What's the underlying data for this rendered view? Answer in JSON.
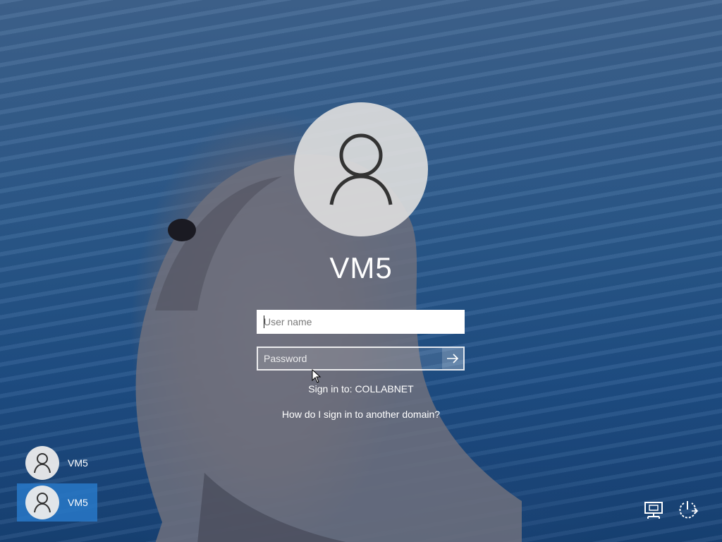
{
  "account": {
    "display_name": "VM5"
  },
  "signin_form": {
    "username_placeholder": "User name",
    "password_placeholder": "Password",
    "submit_icon": "arrow-right-icon",
    "sign_in_to_text": "Sign in to: COLLABNET",
    "other_domain_link": "How do I sign in to another domain?"
  },
  "user_list": [
    {
      "name": "VM5",
      "selected": false,
      "icon": "user-icon"
    },
    {
      "name": "VM5",
      "selected": true,
      "icon": "user-icon"
    }
  ],
  "system_tray": {
    "network_icon": "network-icon",
    "power_icon": "power-icon"
  },
  "colors": {
    "accent": "#2878c8",
    "text": "#ffffff"
  }
}
